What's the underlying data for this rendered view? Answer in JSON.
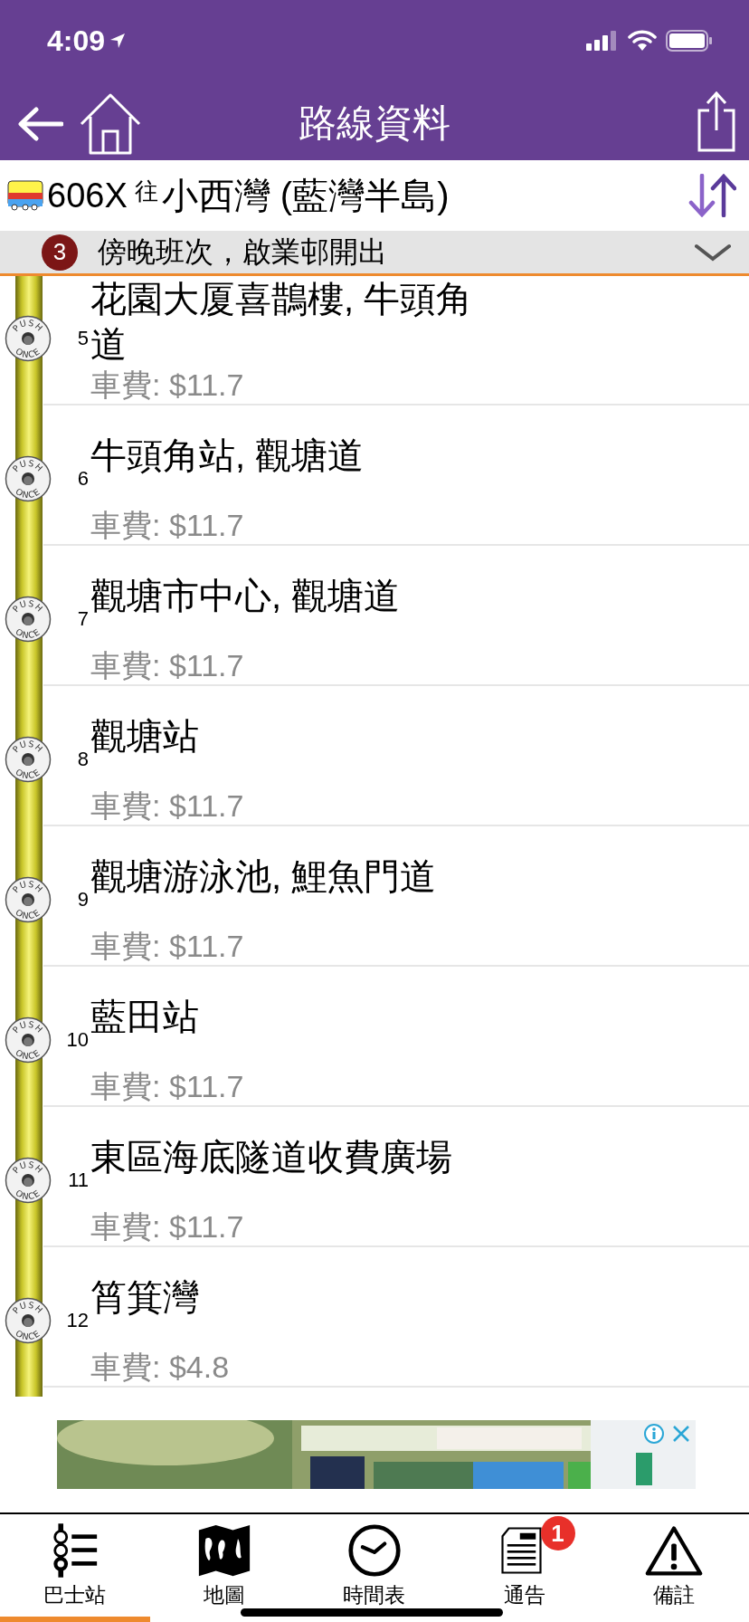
{
  "status_bar": {
    "time": "4:09"
  },
  "nav": {
    "title": "路線資料"
  },
  "route": {
    "number": "606X",
    "direction_prefix": "往",
    "destination": "小西灣 (藍灣半島)"
  },
  "notice": {
    "count": "3",
    "text": "傍晚班次，啟業邨開出",
    "expanded": false
  },
  "stops": [
    {
      "number": "5",
      "name": "花園大厦喜鵲樓, 牛頭角道",
      "fare": "車費: $11.7",
      "bell_top": "PUSH",
      "bell_bottom": "ONCE"
    },
    {
      "number": "6",
      "name": "牛頭角站, 觀塘道",
      "fare": "車費: $11.7",
      "bell_top": "PUSH",
      "bell_bottom": "ONCE"
    },
    {
      "number": "7",
      "name": "觀塘市中心, 觀塘道",
      "fare": "車費: $11.7",
      "bell_top": "PUSH",
      "bell_bottom": "ONCE"
    },
    {
      "number": "8",
      "name": "觀塘站",
      "fare": "車費: $11.7",
      "bell_top": "PUSH",
      "bell_bottom": "ONCE"
    },
    {
      "number": "9",
      "name": "觀塘游泳池, 鯉魚門道",
      "fare": "車費: $11.7",
      "bell_top": "PUSH",
      "bell_bottom": "ONCE"
    },
    {
      "number": "10",
      "name": "藍田站",
      "fare": "車費: $11.7",
      "bell_top": "PUSH",
      "bell_bottom": "ONCE"
    },
    {
      "number": "11",
      "name": "東區海底隧道收費廣場",
      "fare": "車費: $11.7",
      "bell_top": "PUSH",
      "bell_bottom": "ONCE"
    },
    {
      "number": "12",
      "name": "筲箕灣",
      "fare": "車費: $4.8",
      "bell_top": "PUSH",
      "bell_bottom": "ONCE"
    }
  ],
  "tabs": [
    {
      "label": "巴士站",
      "selected": true
    },
    {
      "label": "地圖",
      "selected": false
    },
    {
      "label": "時間表",
      "selected": false
    },
    {
      "label": "通告",
      "selected": false,
      "badge": "1"
    },
    {
      "label": "備註",
      "selected": false
    }
  ]
}
